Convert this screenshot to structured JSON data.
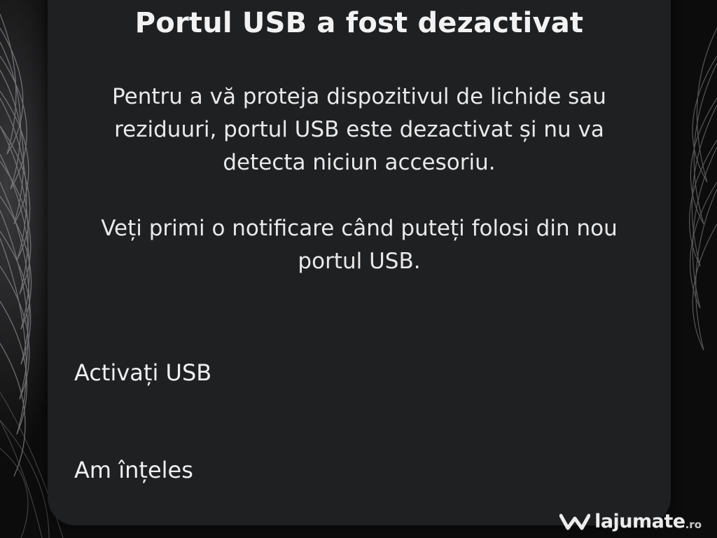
{
  "dialog": {
    "title": "Portul USB a fost dezactivat",
    "body_paragraph_1": "Pentru a vă proteja dispozitivul de lichide sau reziduuri, portul USB este dezactivat și nu va detecta niciun accesoriu.",
    "body_paragraph_2": "Veți primi o notificare când puteți folosi din nou portul USB."
  },
  "actions": {
    "enable_usb_label": "Activați USB",
    "understood_label": "Am înțeles"
  },
  "watermark": {
    "brand": "lajumate",
    "tld": ".ro"
  },
  "colors": {
    "dialog_background": "#1f2022",
    "text": "#f2f2f2",
    "wallpaper": "#0c0c0d"
  }
}
